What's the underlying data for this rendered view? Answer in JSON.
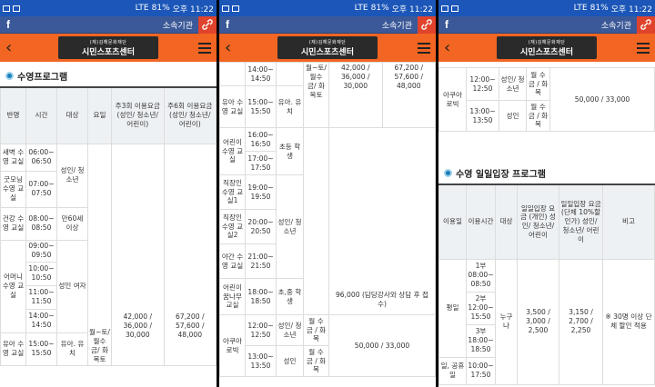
{
  "status": {
    "battery": "81%",
    "time": "오후 11:22",
    "network": "LTE"
  },
  "topbar": {
    "facebook": "f",
    "org_label": "소속기관"
  },
  "header": {
    "logo_sub": "(재)김해문화재단",
    "logo_main": "시민스포츠센터"
  },
  "panel1": {
    "title": "수영프로그램",
    "headers": [
      "반명",
      "시간",
      "대상",
      "요일",
      "주3회 이용요금 (성인/ 청소년/ 어린이)",
      "주6회 이용요금 (성인/ 청소년/ 어린이)"
    ],
    "rows": [
      {
        "class": "새벽 수영 교실",
        "time": "06:00~ 06:50"
      },
      {
        "class": "굿모닝 수영 교실",
        "time": "07:00~ 07:50",
        "target": "성인/ 청소년"
      },
      {
        "class": "건강 수영 교실",
        "time": "08:00~ 08:50",
        "target": "만60세 이상"
      },
      {
        "class": "어머니 수영 교실",
        "time": "09:00~ 09:50"
      },
      {
        "time": "10:00~ 10:50",
        "target": "성인 여자"
      },
      {
        "time": "11:00~ 11:50"
      },
      {
        "time": "14:00~ 14:50"
      },
      {
        "class": "유아 수영 교실",
        "time": "15:00~ 15:50",
        "target": "유아. 유치"
      }
    ],
    "days": "월~토/ 월수 금/ 화목토",
    "fee3": "42,000 / 36,000 / 30,000",
    "fee6": "67,200 / 57,600 / 48,000"
  },
  "panel2": {
    "rows": [
      {
        "class": "",
        "time": "14:00~ 14:50"
      },
      {
        "class": "유아 수영 교실",
        "time": "15:00~ 15:50",
        "target": "유아. 유치"
      },
      {
        "class": "어린이 수영 교실",
        "time": "16:00~ 16:50"
      },
      {
        "time": "17:00~ 17:50",
        "target": "초등 학생"
      },
      {
        "class": "직장인 수영 교실1",
        "time": "19:00~ 19:50"
      },
      {
        "class": "직장인 수영 교실2",
        "time": "20:00~ 20:50",
        "target": "성인/ 청소년"
      },
      {
        "class": "야간 수영 교실",
        "time": "21:00~ 21:50"
      },
      {
        "class": "어린이 꿈나무 교실",
        "time": "18:00~ 18:50",
        "target": "초,중 학생"
      },
      {
        "class": "아쿠아 로빅",
        "time": "12:00~ 12:50",
        "target": "성인/ 청소년"
      },
      {
        "time": "13:00~ 13:50",
        "target": "성인"
      }
    ],
    "days": "월~토/ 월수 금/ 화목토",
    "fee3": "42,000 / 36,000 / 30,000",
    "fee6": "67,200 / 57,600 / 48,000",
    "dream_fee": "96,000 (담당강사와 상담 후 접수)",
    "aqua_days1": "월 수 금 / 화 목",
    "aqua_days2": "월 수 금 / 화 목",
    "aqua_fee": "50,000 / 33,000"
  },
  "panel3": {
    "aqua": {
      "class": "아쿠아 로빅",
      "time1": "12:00~ 12:50",
      "target1": "성인/ 청소년",
      "days1": "월 수 금 / 화 목",
      "time2": "13:00~ 13:50",
      "target2": "성인",
      "days2": "월 수 금 / 화 목",
      "fee": "50,000 / 33,000"
    },
    "title": "수영 일일입장 프로그램",
    "headers": [
      "이용일",
      "이용시간",
      "대상",
      "일일입장 요금 (개인) 성인/ 청소년/ 어린이",
      "일일입장 요금 (단체 10%할인가) 성인/ 청소년/ 어린이",
      "비고"
    ],
    "weekday": "평일",
    "parts": [
      "1부 08:00~ 08:50",
      "2부 12:00~ 15:50",
      "3부 18:00~ 18:50"
    ],
    "target": "누구 나",
    "fee_personal": "3,500 / 3,000 / 2,500",
    "fee_group": "3,150 / 2,700 / 2,250",
    "note": "※ 30명 이상 단체 할인 적용",
    "holiday": "일, 공휴일",
    "holiday_time": "10:00~ 17:50"
  }
}
